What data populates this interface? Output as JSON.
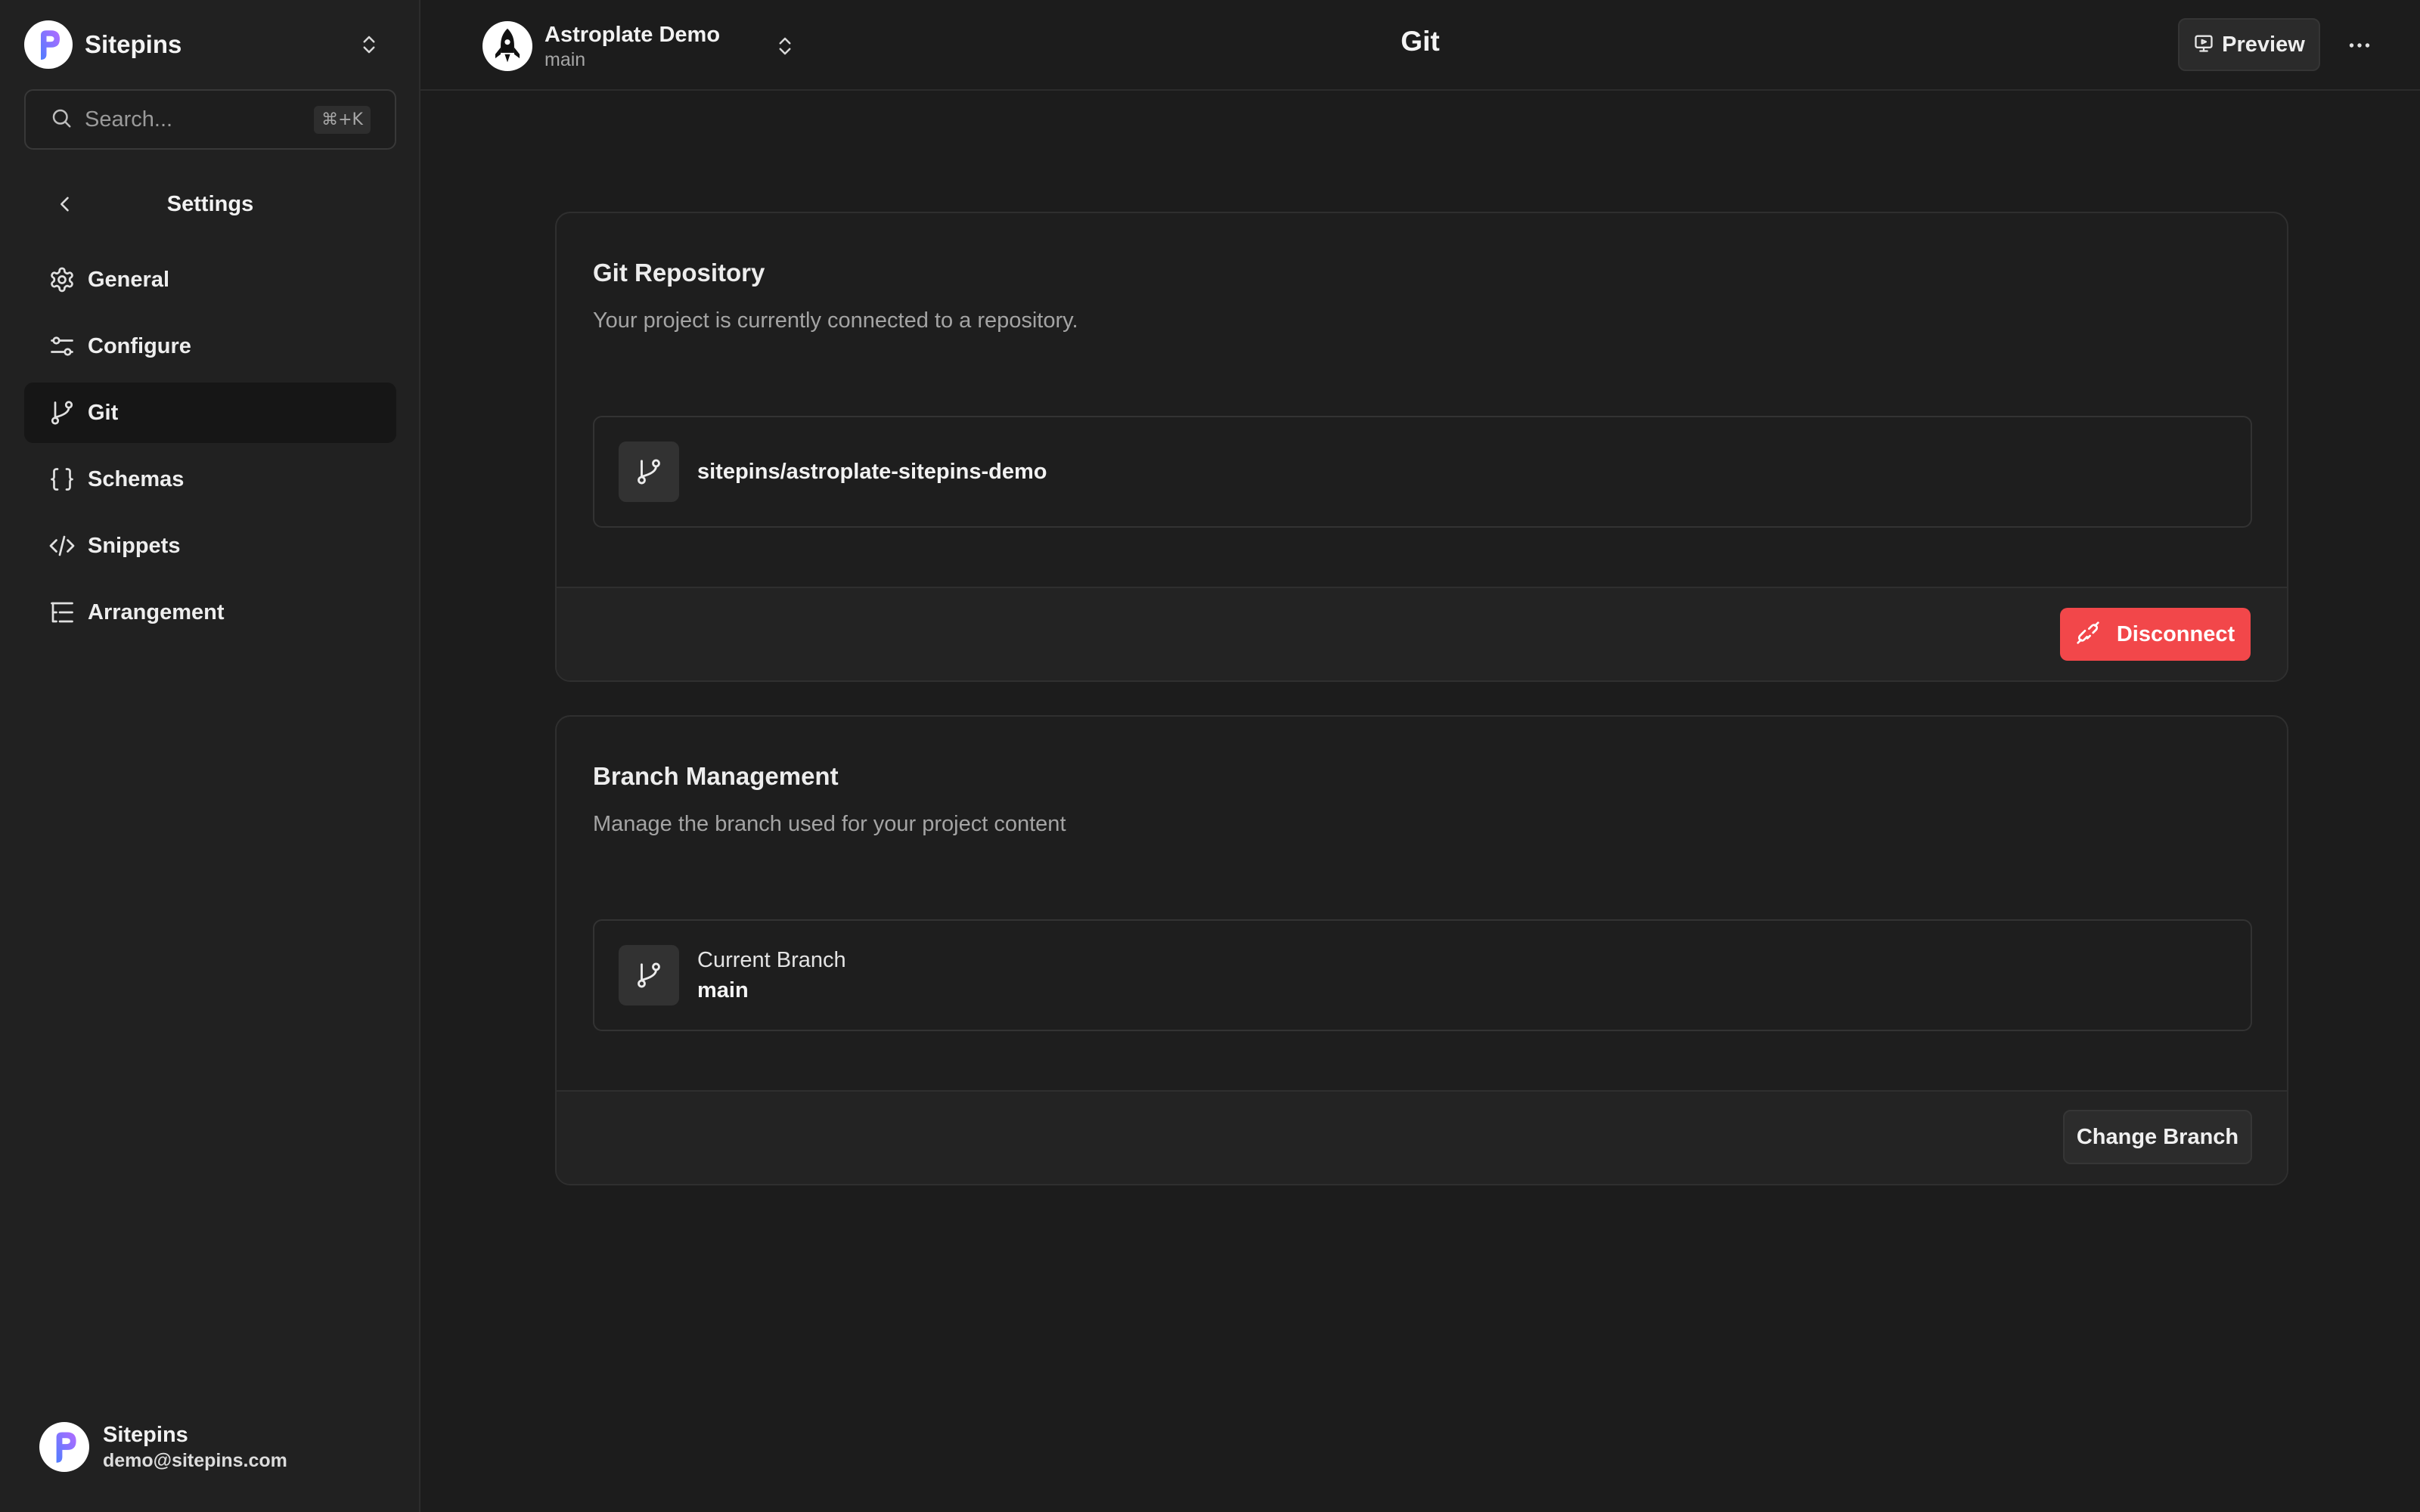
{
  "sidebar": {
    "org_name": "Sitepins",
    "search": {
      "placeholder": "Search...",
      "shortcut": "⌘+K"
    },
    "section_title": "Settings",
    "items": [
      {
        "label": "General",
        "icon": "gear-icon",
        "active": false
      },
      {
        "label": "Configure",
        "icon": "sliders-icon",
        "active": false
      },
      {
        "label": "Git",
        "icon": "git-branch-icon",
        "active": true
      },
      {
        "label": "Schemas",
        "icon": "braces-icon",
        "active": false
      },
      {
        "label": "Snippets",
        "icon": "code-icon",
        "active": false
      },
      {
        "label": "Arrangement",
        "icon": "list-tree-icon",
        "active": false
      }
    ],
    "user": {
      "name": "Sitepins",
      "email": "demo@sitepins.com"
    }
  },
  "topbar": {
    "project_name": "Astroplate Demo",
    "project_branch": "main",
    "page_title": "Git",
    "preview_label": "Preview"
  },
  "git_repository": {
    "title": "Git Repository",
    "description": "Your project is currently connected to a repository.",
    "repo": "sitepins/astroplate-sitepins-demo",
    "disconnect_label": "Disconnect"
  },
  "branch_management": {
    "title": "Branch Management",
    "description": "Manage the branch used for your project content",
    "current_branch_label": "Current Branch",
    "current_branch_value": "main",
    "change_label": "Change Branch"
  },
  "colors": {
    "background": "#1c1c1c",
    "sidebar": "#212121",
    "danger": "#f2474a",
    "logo_gradient": [
      "#4f7dff",
      "#b36bff"
    ]
  }
}
